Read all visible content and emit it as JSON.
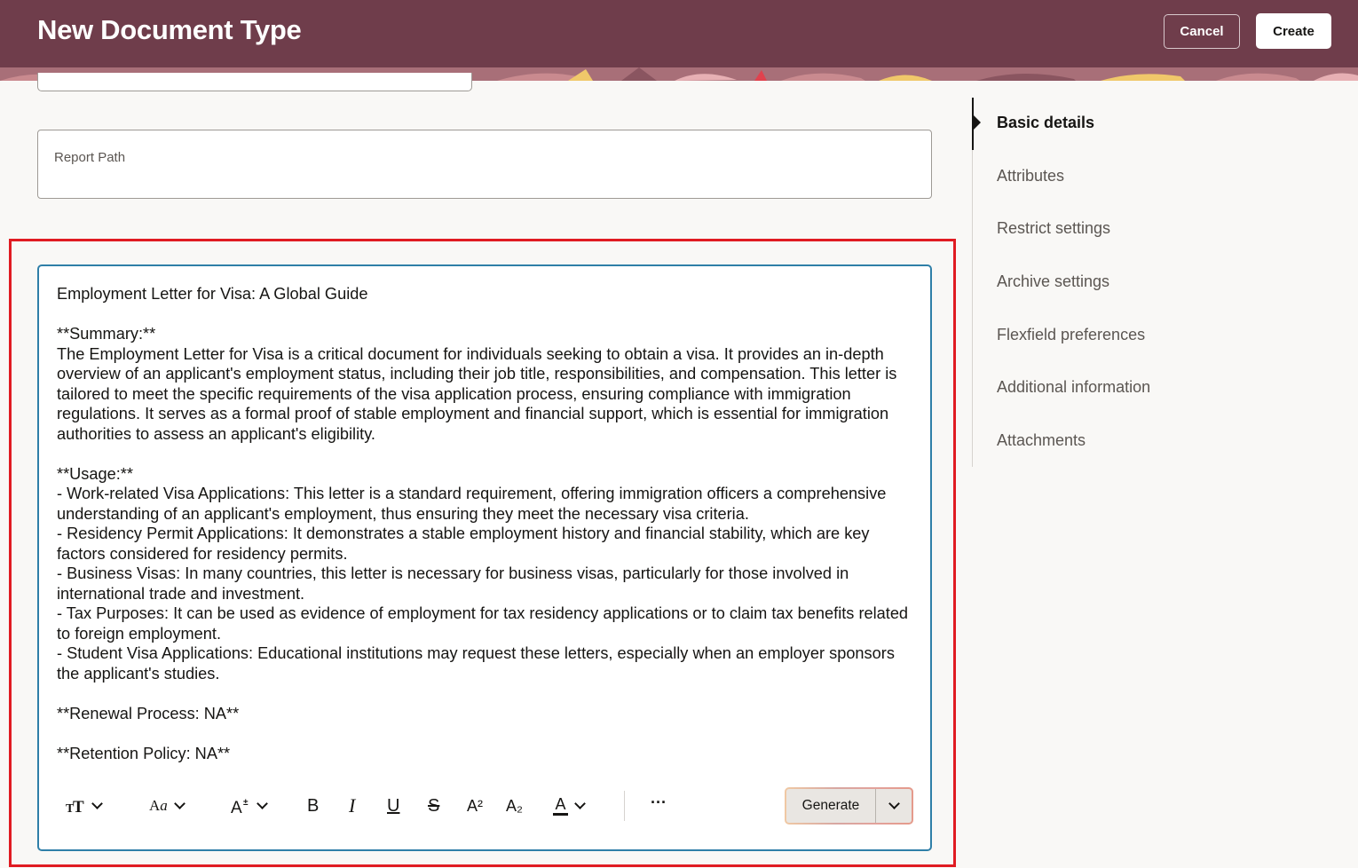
{
  "header": {
    "title": "New Document Type",
    "cancel_label": "Cancel",
    "create_label": "Create"
  },
  "form": {
    "report_path_label": "Report Path"
  },
  "editor": {
    "content": "Employment Letter for Visa: A Global Guide\n\n**Summary:**\nThe Employment Letter for Visa is a critical document for individuals seeking to obtain a visa. It provides an in-depth overview of an applicant's employment status, including their job title, responsibilities, and compensation. This letter is tailored to meet the specific requirements of the visa application process, ensuring compliance with immigration regulations. It serves as a formal proof of stable employment and financial support, which is essential for immigration authorities to assess an applicant's eligibility.\n\n**Usage:**\n- Work-related Visa Applications: This letter is a standard requirement, offering immigration officers a comprehensive understanding of an applicant's employment, thus ensuring they meet the necessary visa criteria.\n- Residency Permit Applications: It demonstrates a stable employment history and financial stability, which are key factors considered for residency permits.\n- Business Visas: In many countries, this letter is necessary for business visas, particularly for those involved in international trade and investment.\n- Tax Purposes: It can be used as evidence of employment for tax residency applications or to claim tax benefits related to foreign employment.\n- Student Visa Applications: Educational institutions may request these letters, especially when an employer sponsors the applicant's studies.\n\n**Renewal Process: NA**\n\n**Retention Policy: NA**",
    "toolbar": {
      "text_style_icon": "text-size-icon",
      "font_icon": "font-family-icon",
      "font_size_icon": "font-size-icon",
      "bold_glyph": "B",
      "italic_glyph": "I",
      "underline_glyph": "U",
      "strike_glyph": "S",
      "superscript_glyph": "A²",
      "subscript_glyph": "A₂",
      "color_glyph": "A",
      "more_glyph": "···",
      "generate_label": "Generate"
    }
  },
  "nav": {
    "items": [
      {
        "label": "Basic details",
        "active": true
      },
      {
        "label": "Attributes"
      },
      {
        "label": "Restrict settings"
      },
      {
        "label": "Archive settings"
      },
      {
        "label": "Flexfield preferences"
      },
      {
        "label": "Additional information"
      },
      {
        "label": "Attachments"
      }
    ]
  },
  "colors": {
    "header_bg": "#6f3d4b",
    "highlight": "#e01b22",
    "editor_border": "#2f7fa8"
  }
}
